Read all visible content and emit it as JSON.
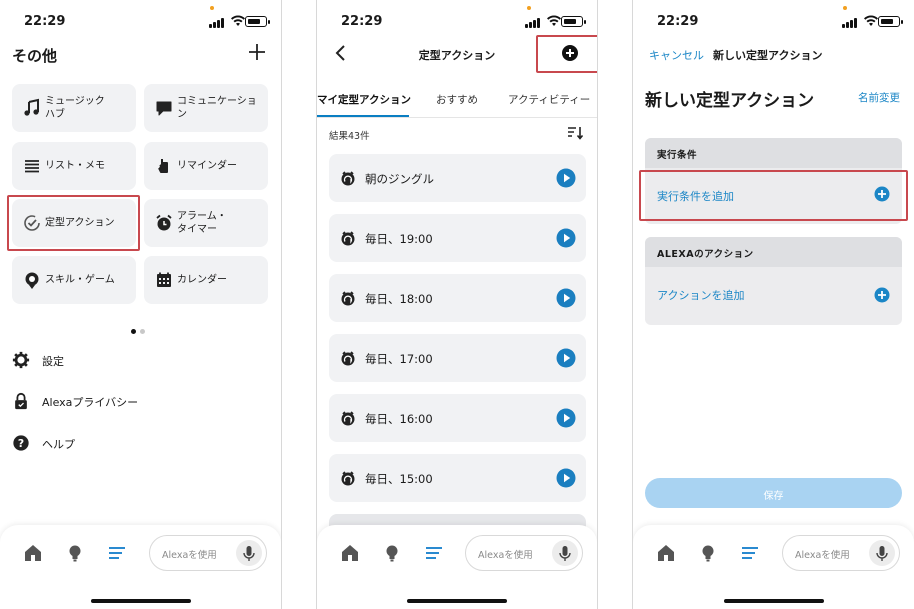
{
  "status": {
    "time": "22:29"
  },
  "panel1": {
    "title": "その他",
    "grid": [
      {
        "label": "ミュージック\nハブ",
        "icon": "music-note-icon"
      },
      {
        "label": "コミュニケーション",
        "icon": "chat-bubble-icon"
      },
      {
        "label": "リスト・メモ",
        "icon": "list-icon"
      },
      {
        "label": "リマインダー",
        "icon": "reminder-hand-icon"
      },
      {
        "label": "定型アクション",
        "icon": "routine-check-icon"
      },
      {
        "label": "アラーム・\nタイマー",
        "icon": "alarm-clock-icon"
      },
      {
        "label": "スキル・ゲーム",
        "icon": "skill-badge-icon"
      },
      {
        "label": "カレンダー",
        "icon": "calendar-icon"
      }
    ],
    "menu": [
      {
        "label": "設定",
        "icon": "gear-icon"
      },
      {
        "label": "Alexaプライバシー",
        "icon": "privacy-lock-icon"
      },
      {
        "label": "ヘルプ",
        "icon": "help-icon"
      }
    ]
  },
  "panel2": {
    "title": "定型アクション",
    "tabs": [
      "マイ定型アクション",
      "おすすめ",
      "アクティビティー"
    ],
    "results": "結果43件",
    "routines": [
      "朝のジングル",
      "毎日、19:00",
      "毎日、18:00",
      "毎日、17:00",
      "毎日、16:00",
      "毎日、15:00"
    ]
  },
  "panel3": {
    "cancel": "キャンセル",
    "nav_title": "新しい定型アクション",
    "title": "新しい定型アクション",
    "rename": "名前変更",
    "trigger_header": "実行条件",
    "trigger_add": "実行条件を追加",
    "action_header": "ALEXAのアクション",
    "action_add": "アクションを追加",
    "save": "保存"
  },
  "tabbar": {
    "alexa_placeholder": "Alexaを使用"
  },
  "colors": {
    "accent": "#1b86c6",
    "highlight": "#c8484e",
    "card": "#f1f2f4"
  }
}
